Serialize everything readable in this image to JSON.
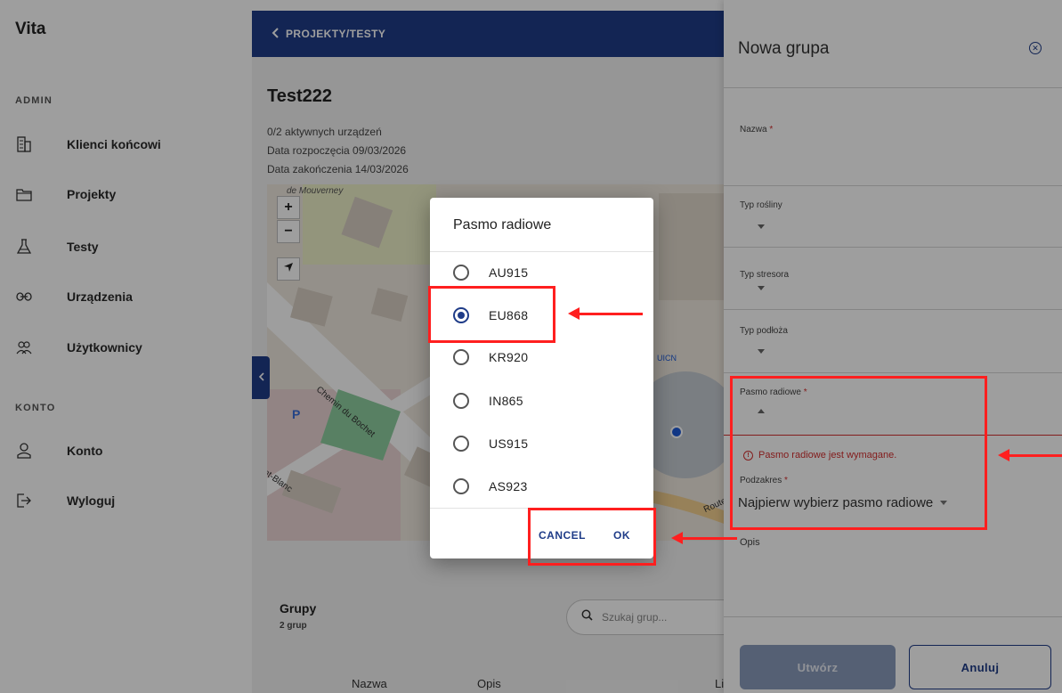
{
  "sidebar": {
    "logo": "Vita",
    "admin_label": "ADMIN",
    "account_label": "KONTO",
    "admin_items": [
      {
        "label": "Klienci końcowi",
        "icon": "building-icon"
      },
      {
        "label": "Projekty",
        "icon": "folder-icon"
      },
      {
        "label": "Testy",
        "icon": "flask-icon"
      },
      {
        "label": "Urządzenia",
        "icon": "link-icon"
      },
      {
        "label": "Użytkownicy",
        "icon": "users-icon"
      }
    ],
    "account_items": [
      {
        "label": "Konto",
        "icon": "user-icon"
      },
      {
        "label": "Wyloguj",
        "icon": "logout-icon"
      }
    ]
  },
  "main": {
    "breadcrumb": "PROJEKTY/TESTY",
    "title": "Test222",
    "active_devices": "0/2 aktywnych urządzeń",
    "start_date": "Data rozpoczęcia 09/03/2026",
    "end_date": "Data zakończenia 14/03/2026",
    "map_labels": [
      "de Mouverney",
      "Chemin du Bochet",
      "nt-Blanc",
      "Route",
      "UICN",
      "P"
    ],
    "map_zoom_in": "+",
    "map_zoom_out": "−",
    "groups": {
      "title": "Grupy",
      "count": "2 grup",
      "search_placeholder": "Szukaj grup...",
      "columns": [
        "Nazwa",
        "Opis",
        "Licz"
      ]
    }
  },
  "dialog": {
    "title": "Pasmo radiowe",
    "options": [
      {
        "label": "AU915",
        "checked": false
      },
      {
        "label": "EU868",
        "checked": true
      },
      {
        "label": "KR920",
        "checked": false
      },
      {
        "label": "IN865",
        "checked": false
      },
      {
        "label": "US915",
        "checked": false
      },
      {
        "label": "AS923",
        "checked": false
      }
    ],
    "cancel_label": "CANCEL",
    "ok_label": "OK"
  },
  "panel": {
    "title": "Nowa grupa",
    "fields": {
      "name_label": "Nazwa",
      "plant_type_label": "Typ rośliny",
      "stressor_type_label": "Typ stresora",
      "substrate_type_label": "Typ podłoża",
      "radio_band_label": "Pasmo radiowe",
      "radio_band_error": "Pasmo radiowe jest wymagane.",
      "subrange_label": "Podzakres",
      "subrange_value": "Najpierw wybierz pasmo radiowe",
      "description_label": "Opis",
      "required_mark": "*"
    },
    "create_label": "Utwórz",
    "cancel_label": "Anuluj"
  },
  "colors": {
    "primary": "#1f3c88",
    "error": "#d32f2f",
    "annotation": "#ff1f1f",
    "disabled_button": "#8a9bbb"
  }
}
